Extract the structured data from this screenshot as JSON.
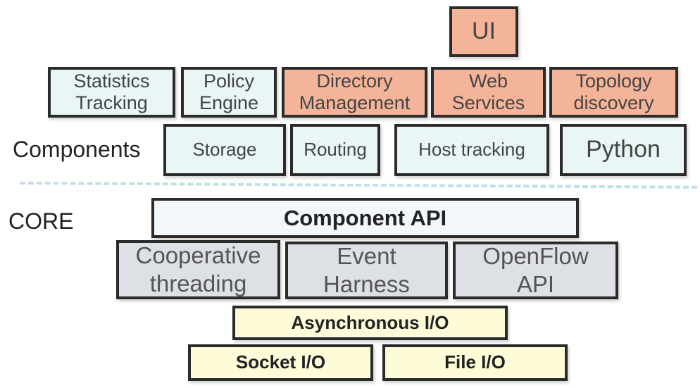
{
  "labels": {
    "components": "Components",
    "core": "CORE"
  },
  "top": {
    "ui": "UI"
  },
  "components_row1": [
    "Statistics\nTracking",
    "Policy\nEngine",
    "Directory\nManagement",
    "Web\nServices",
    "Topology\ndiscovery"
  ],
  "components_row2": [
    "Storage",
    "Routing",
    "Host tracking",
    "Python"
  ],
  "core": {
    "component_api": "Component API",
    "middle": [
      "Cooperative\nthreading",
      "Event\nHarness",
      "OpenFlow\nAPI"
    ],
    "async_io": "Asynchronous I/O",
    "socket_io": "Socket I/O",
    "file_io": "File I/O"
  },
  "colors": {
    "app_fill": "#f4b49a",
    "component_fill": "#eaf5f5",
    "api_fill": "#f2f7fc",
    "core_fill": "#dde0e4",
    "io_fill": "#fefbd8",
    "border": "#2b2b2b",
    "divider": "#bfe1e3"
  }
}
